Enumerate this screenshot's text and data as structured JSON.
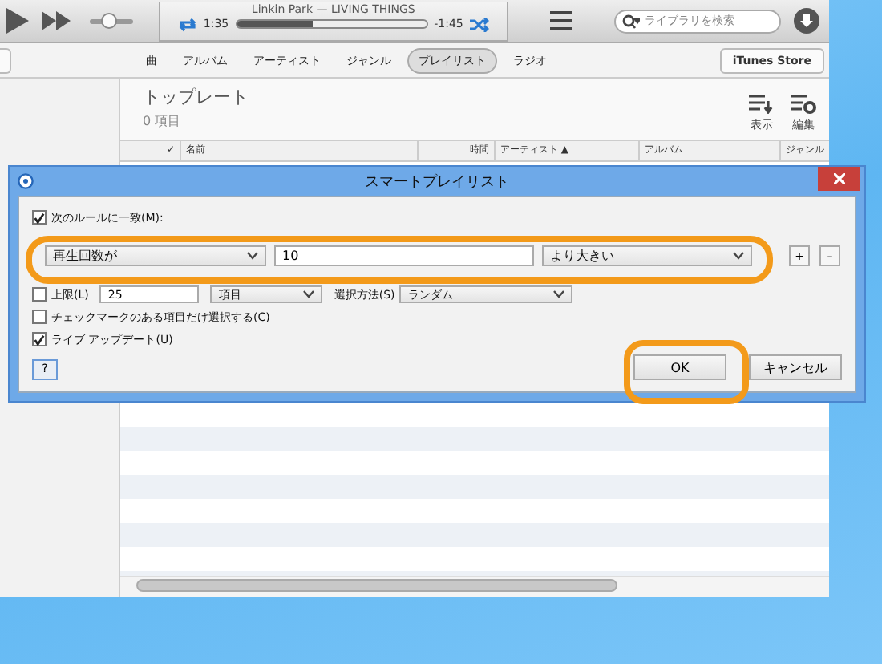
{
  "player": {
    "song": "Linkin Park — LIVING THINGS",
    "elapsed": "1:35",
    "remaining": "-1:45",
    "progress": {
      "level": 0.4
    },
    "volume": {
      "level": 0.45
    }
  },
  "search": {
    "placeholder": "ライブラリを検索"
  },
  "nav_tabs": [
    {
      "label": "曲",
      "selected": false
    },
    {
      "label": "アルバム",
      "selected": false
    },
    {
      "label": "アーティスト",
      "selected": false
    },
    {
      "label": "ジャンル",
      "selected": false
    },
    {
      "label": "プレイリスト",
      "selected": true
    },
    {
      "label": "ラジオ",
      "selected": false
    }
  ],
  "store_button": "iTunes Store",
  "playlist": {
    "title": "トップレート",
    "count": "0 項目",
    "actions": [
      {
        "label": "表示",
        "kind": "view"
      },
      {
        "label": "編集",
        "kind": "edit"
      }
    ]
  },
  "columns": [
    {
      "label": "✓"
    },
    {
      "label": "名前"
    },
    {
      "label": "時間"
    },
    {
      "label": "アーティスト ▲"
    },
    {
      "label": "アルバム"
    },
    {
      "label": "ジャンル"
    }
  ],
  "dialog": {
    "title": "スマートプレイリスト",
    "match": {
      "label": "次のルールに一致(M):",
      "checked": true
    },
    "rule": {
      "field": "再生回数が",
      "value": "10",
      "operator": "より大きい"
    },
    "rule_buttons": [
      "+",
      "–"
    ],
    "limit": {
      "label": "上限(L)",
      "checked": false,
      "value": "25",
      "unit": "項目",
      "method_label": "選択方法(S)",
      "method": "ランダム"
    },
    "options": [
      {
        "label": "チェックマークのある項目だけ選択する(C)",
        "checked": false
      },
      {
        "label": "ライブ アップデート(U)",
        "checked": true
      }
    ],
    "help": "?",
    "buttons": [
      {
        "label": "OK"
      },
      {
        "label": "キャンセル"
      }
    ]
  }
}
